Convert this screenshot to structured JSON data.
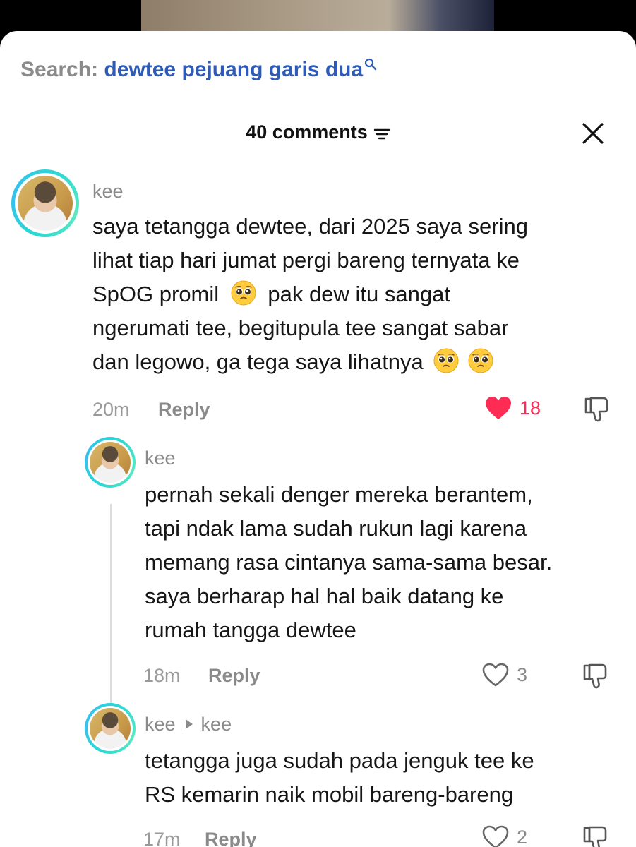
{
  "search": {
    "prefix": "Search:",
    "query": "dewtee pejuang garis dua"
  },
  "header": {
    "comments_count": "40 comments"
  },
  "comments": [
    {
      "username": "kee",
      "text_lines": [
        "saya tetangga dewtee, dari 2025 saya sering",
        "lihat tiap hari jumat pergi bareng ternyata ke",
        "SpOG promil",
        "pak dew itu sangat",
        "ngerumati tee, begitupula tee sangat sabar",
        "dan legowo, ga tega saya lihatnya"
      ],
      "time": "20m",
      "reply_label": "Reply",
      "likes": "18",
      "liked": true,
      "emojis": [
        "pleading-face-emoji",
        "pleading-face-emoji",
        "pleading-face-emoji"
      ]
    },
    {
      "username": "kee",
      "text_lines": [
        "pernah sekali denger mereka berantem,",
        "tapi ndak lama sudah rukun lagi karena",
        "memang rasa cintanya sama-sama besar.",
        "saya berharap hal hal baik datang ke",
        "rumah tangga dewtee"
      ],
      "time": "18m",
      "reply_label": "Reply",
      "likes": "3",
      "liked": false
    },
    {
      "username": "kee",
      "reply_to": "kee",
      "text_lines": [
        "tetangga juga sudah pada jenguk tee ke",
        "RS kemarin naik mobil bareng-bareng"
      ],
      "time": "17m",
      "reply_label": "Reply",
      "likes": "2",
      "liked": false
    }
  ],
  "colors": {
    "accent_like": "#fe2c55",
    "link": "#2e5bb8",
    "avatar_ring": "#2ad8d3"
  }
}
